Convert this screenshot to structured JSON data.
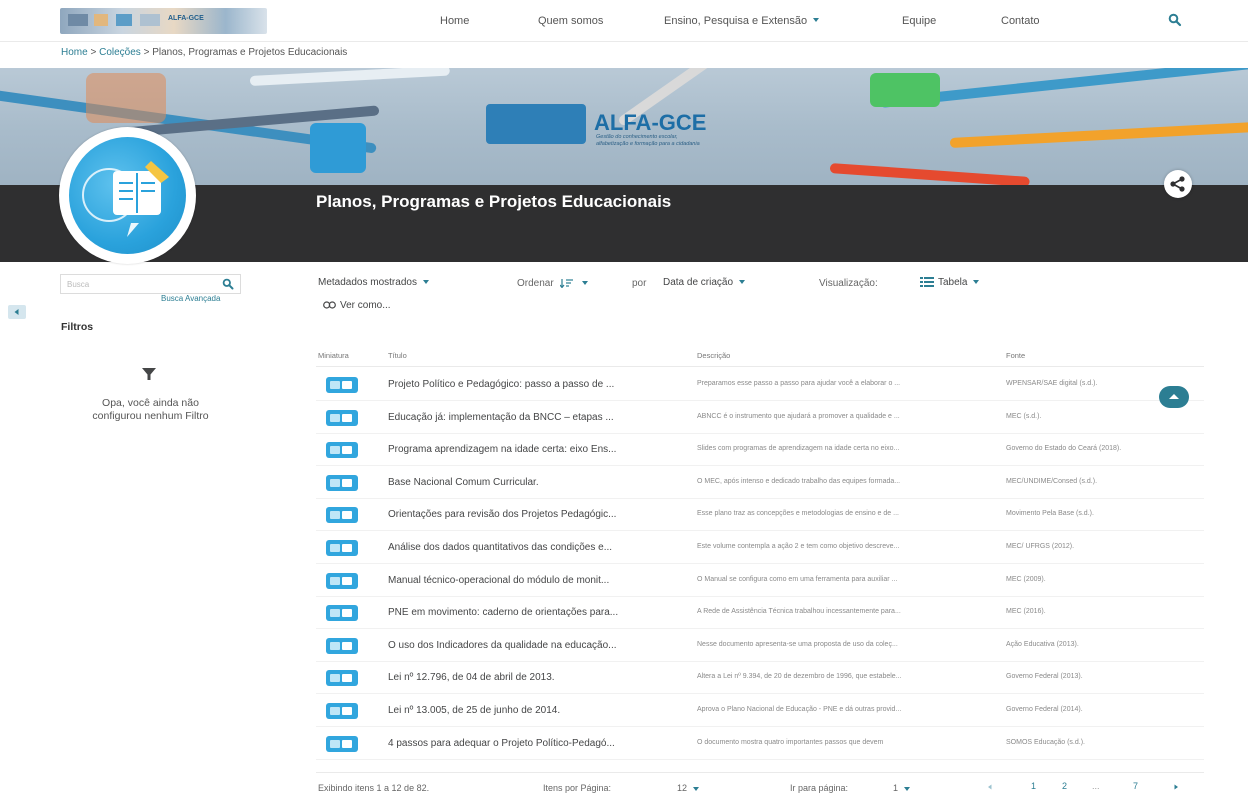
{
  "header": {
    "logo_text": "ALFA-GCE",
    "nav": {
      "home": "Home",
      "about": "Quem somos",
      "teaching": "Ensino, Pesquisa e Extensão",
      "team": "Equipe",
      "contact": "Contato"
    }
  },
  "breadcrumb": {
    "home": "Home",
    "collections": "Coleções",
    "current": "Planos, Programas e Projetos Educacionais",
    "separator": ">"
  },
  "banner": {
    "title": "ALFA-GCE",
    "subtitle_line1": "Gestão do conhecimento escolar,",
    "subtitle_line2": "alfabetização e formação para a cidadania"
  },
  "collection": {
    "title": "Planos, Programas e Projetos Educacionais"
  },
  "sidebar": {
    "search_placeholder": "Busca",
    "advanced_search": "Busca Avançada",
    "filters_title": "Filtros",
    "no_filters_line1": "Opa, você ainda não",
    "no_filters_line2": "configurou nenhum Filtro"
  },
  "toolbar": {
    "metadata_shown": "Metadados mostrados",
    "sort": "Ordenar",
    "by": "por",
    "sort_field": "Data de criação",
    "view_label": "Visualização:",
    "view_mode": "Tabela",
    "view_as": "Ver como..."
  },
  "table": {
    "columns": [
      "Miniatura",
      "Título",
      "Descrição",
      "Fonte"
    ],
    "rows": [
      {
        "title": "Projeto Político e Pedagógico: passo a passo de ...",
        "description": "Preparamos esse passo a passo para ajudar você a elaborar o ...",
        "source": "WPENSAR/SAE digital (s.d.)."
      },
      {
        "title": "Educação já: implementação da BNCC – etapas ...",
        "description": "ABNCC é o instrumento que ajudará a promover a qualidade e ...",
        "source": "MEC (s.d.)."
      },
      {
        "title": "Programa aprendizagem na idade certa: eixo Ens...",
        "description": "Slides com programas de aprendizagem na idade certa no eixo...",
        "source": "Governo do Estado do Ceará (2018)."
      },
      {
        "title": "Base Nacional Comum Curricular.",
        "description": "O MEC, após intenso e dedicado trabalho das equipes formada...",
        "source": "MEC/UNDIME/Consed (s.d.)."
      },
      {
        "title": "Orientações para revisão dos Projetos Pedagógic...",
        "description": "Esse plano traz as concepções e metodologias de ensino e de ...",
        "source": "Movimento Pela Base (s.d.)."
      },
      {
        "title": "Análise dos dados quantitativos das condições e...",
        "description": "Este volume contempla a ação 2 e tem como objetivo descreve...",
        "source": "MEC/ UFRGS (2012)."
      },
      {
        "title": "Manual técnico-operacional do módulo de monit...",
        "description": "O Manual se configura como em uma ferramenta para auxiliar ...",
        "source": "MEC (2009)."
      },
      {
        "title": "PNE em movimento: caderno de orientações para...",
        "description": "A Rede de Assistência Técnica trabalhou incessantemente para...",
        "source": "MEC (2016)."
      },
      {
        "title": "O uso dos Indicadores da qualidade na educação...",
        "description": "Nesse documento apresenta-se uma proposta de uso da coleç...",
        "source": "Ação Educativa (2013)."
      },
      {
        "title": "Lei nº 12.796, de 04 de abril de 2013.",
        "description": "Altera a Lei nº 9.394, de 20 de dezembro de 1996, que estabele...",
        "source": "Governo Federal (2013)."
      },
      {
        "title": "Lei nº 13.005, de 25 de junho de 2014.",
        "description": "Aprova o Plano Nacional de Educação - PNE e dá outras provid...",
        "source": "Governo Federal (2014)."
      },
      {
        "title": "4 passos para adequar o Projeto Político-Pedagó...",
        "description": "O documento mostra quatro importantes passos que devem",
        "source": "SOMOS Educação (s.d.)."
      }
    ]
  },
  "pagination": {
    "showing": "Exibindo itens 1 a 12 de 82.",
    "per_page_label": "Itens por Página:",
    "per_page_value": "12",
    "goto_label": "Ir para página:",
    "goto_value": "1",
    "pages": [
      "1",
      "2",
      "...",
      "7"
    ]
  },
  "colors": {
    "accent": "#2c7e93",
    "dark_band": "#2f2f30",
    "thumb_blue": "#31a6de"
  },
  "icons": {
    "search": "search-icon",
    "share": "share-icon",
    "filter": "funnel-icon",
    "view": "table-view-icon",
    "link": "link-icon",
    "sort": "sort-icon",
    "back_to_top": "chevron-up-icon"
  }
}
